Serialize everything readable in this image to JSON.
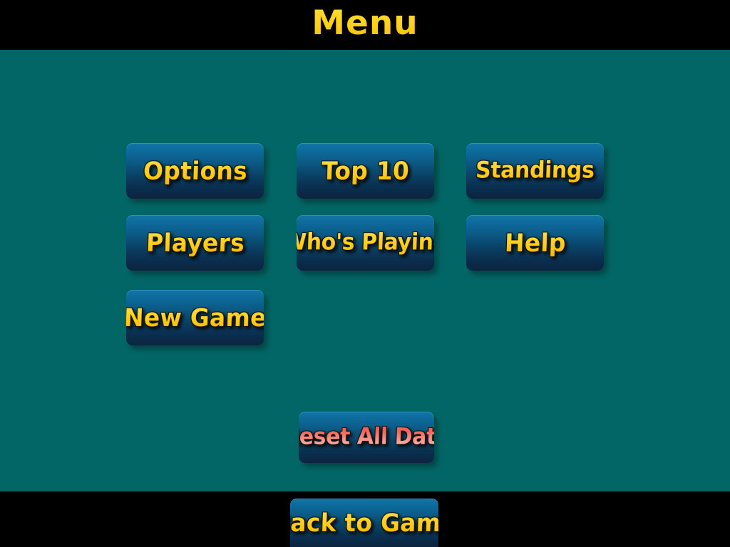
{
  "screen": {
    "title": "Menu",
    "background_color": "#036666",
    "bar_color": "#000000",
    "button_gradient_top": "#1176a6",
    "button_gradient_bottom": "#0b2440",
    "label_color": "#ffd22a",
    "danger_label_color": "#f4655c"
  },
  "menu": {
    "buttons": [
      {
        "id": "options",
        "label": "Options"
      },
      {
        "id": "top10",
        "label": "Top 10"
      },
      {
        "id": "standings",
        "label": "Standings"
      },
      {
        "id": "players",
        "label": "Players"
      },
      {
        "id": "whos_playing",
        "label": "Who's Playing"
      },
      {
        "id": "help",
        "label": "Help"
      },
      {
        "id": "new_game",
        "label": "New Game"
      }
    ],
    "reset": {
      "id": "reset_all_data",
      "label": "Reset All Data"
    }
  },
  "footer": {
    "back_button": {
      "id": "back_to_game",
      "label": "Back to Game"
    }
  }
}
